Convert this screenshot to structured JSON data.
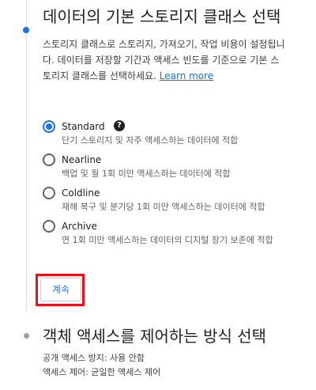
{
  "step_storage_class": {
    "title": "데이터의 기본 스토리지 클래스 선택",
    "description": "스토리지 클래스로 스토리지, 가져오기, 작업 비용이 설정됩니다. 데이터를 저장할 기간과 액세스 빈도를 기준으로 기본 스토리지 클래스를 선택하세요.",
    "learn_more": "Learn more",
    "options": [
      {
        "label": "Standard",
        "description": "단기 스토리지 및 자주 액세스하는 데이터에 적합",
        "selected": true
      },
      {
        "label": "Nearline",
        "description": "백업 및 월 1회 미만 액세스하는 데이터에 적합",
        "selected": false
      },
      {
        "label": "Coldline",
        "description": "재해 복구 및 분기당 1회 미만 액세스하는 데이터에 적합",
        "selected": false
      },
      {
        "label": "Archive",
        "description": "연 1회 미만 액세스하는 데이터의 디지털 장기 보존에 적합",
        "selected": false
      }
    ],
    "help_icon": "help-icon",
    "continue_label": "계속"
  },
  "step_access_control": {
    "title": "객체 액세스를 제어하는 방식 선택",
    "public_access": "공개 액세스 방지: 사용 안함",
    "access_control": "액세스 제어: 균일한 액세스 제어"
  },
  "colors": {
    "accent": "#1a73e8",
    "highlight": "#e8101a",
    "text": "#202124",
    "muted": "#5f6368"
  }
}
